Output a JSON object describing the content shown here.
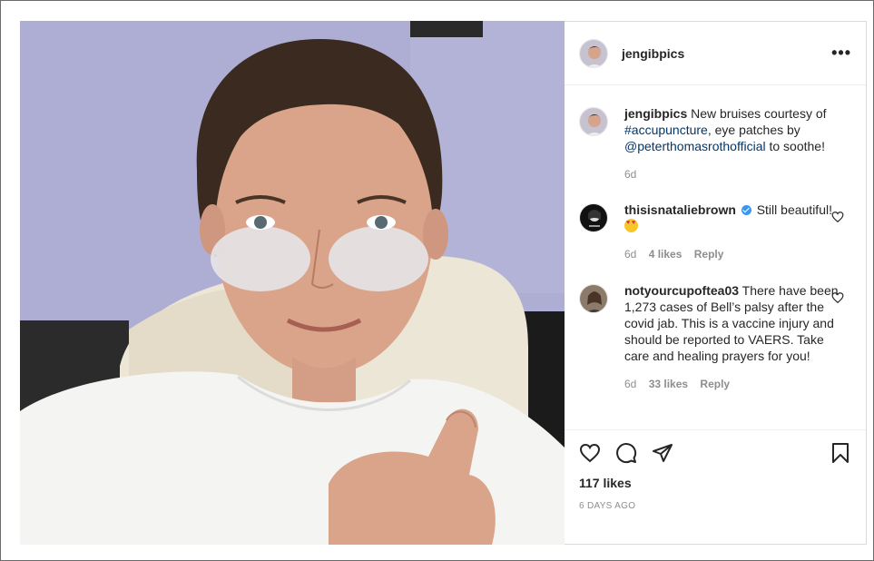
{
  "post": {
    "author": "jengibpics",
    "more_label": "•••",
    "caption": {
      "username": "jengibpics",
      "text_before": "New bruises courtesy of",
      "hashtag": "#accupuncture",
      "text_middle": ", eye patches by",
      "mention": "@peterthomasrothofficial",
      "text_after": "to soothe!",
      "time": "6d"
    },
    "comments": [
      {
        "username": "thisisnataliebrown",
        "verified": true,
        "text_line1": "Still",
        "text_line2": "beautiful!",
        "time": "6d",
        "likes": "4 likes",
        "reply": "Reply"
      },
      {
        "username": "notyourcupoftea03",
        "text": "There have been 1,273 cases of Bell’s palsy after the covid jab. This is a vaccine injury and should be reported to VAERS. Take care and healing prayers for you!",
        "time": "6d",
        "likes": "33 likes",
        "reply": "Reply"
      }
    ],
    "likes_count": "117 likes",
    "posted": "6 DAYS AGO"
  },
  "icons": [
    "heart-icon",
    "comment-icon",
    "share-icon",
    "bookmark-icon",
    "more-icon",
    "verified-badge-icon",
    "heart-eyes-emoji-icon"
  ],
  "colors": {
    "link": "#00376b",
    "meta": "#8e8e8e",
    "verified": "#3897f0",
    "border": "#dbdbdb"
  }
}
